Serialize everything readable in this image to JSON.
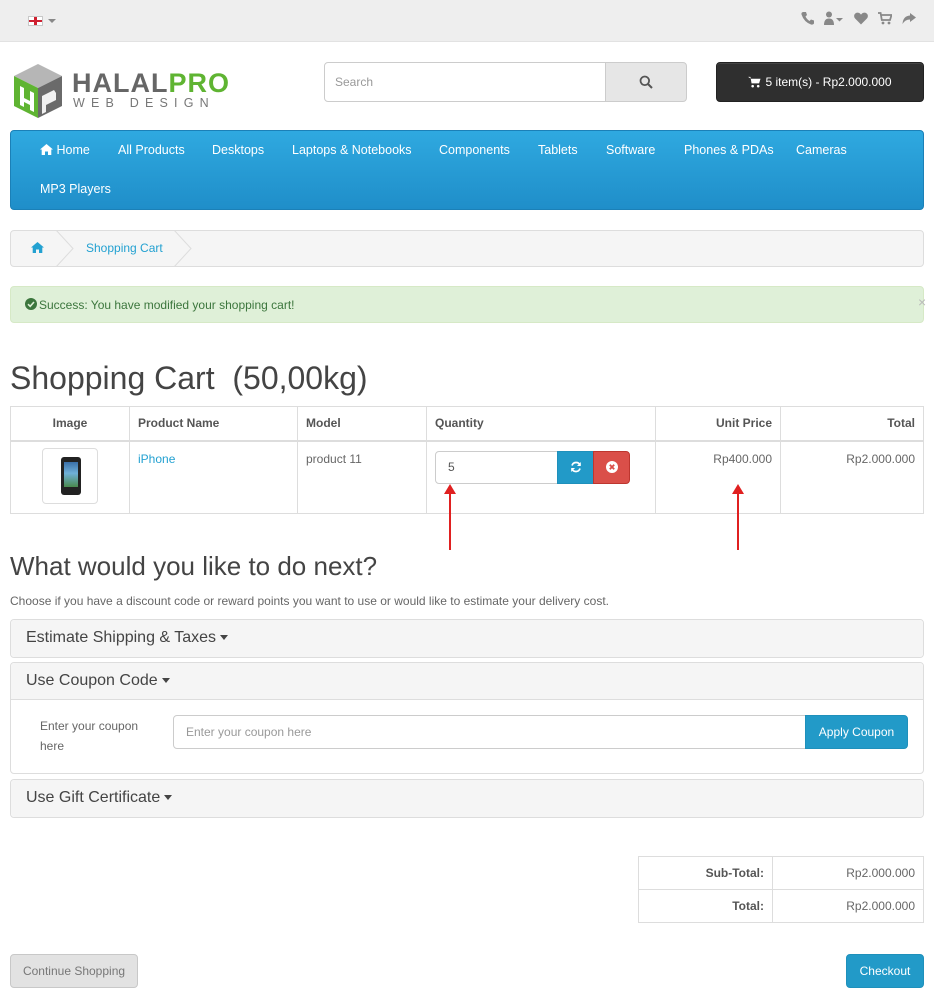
{
  "header": {
    "logo_main_a": "HALAL",
    "logo_main_b": "PRO",
    "logo_sub": "WEB DESIGN",
    "search_placeholder": "Search",
    "cart_label": "5 item(s) - Rp2.000.000"
  },
  "nav": {
    "items": [
      "Home",
      "All Products",
      "Desktops",
      "Laptops & Notebooks",
      "Components",
      "Tablets",
      "Software",
      "Phones & PDAs",
      "Cameras",
      "MP3 Players"
    ]
  },
  "breadcrumb": {
    "current": "Shopping Cart"
  },
  "alert": {
    "message": "Success: You have modified your shopping cart!",
    "close": "×"
  },
  "cart": {
    "title": "Shopping Cart  (50,00kg)",
    "columns": [
      "Image",
      "Product Name",
      "Model",
      "Quantity",
      "Unit Price",
      "Total"
    ],
    "rows": [
      {
        "product_name": "iPhone",
        "model": "product 11",
        "quantity": "5",
        "unit_price": "Rp400.000",
        "total": "Rp2.000.000"
      }
    ]
  },
  "next": {
    "title": "What would you like to do next?",
    "intro": "Choose if you have a discount code or reward points you want to use or would like to estimate your delivery cost.",
    "shipping_title": "Estimate Shipping & Taxes",
    "coupon_title": "Use Coupon Code",
    "coupon_label": "Enter your coupon here",
    "coupon_placeholder": "Enter your coupon here",
    "coupon_button": "Apply Coupon",
    "gift_title": "Use Gift Certificate"
  },
  "totals": {
    "subtotal_label": "Sub-Total:",
    "subtotal_value": "Rp2.000.000",
    "total_label": "Total:",
    "total_value": "Rp2.000.000"
  },
  "buttons": {
    "continue": "Continue Shopping",
    "checkout": "Checkout"
  },
  "colors": {
    "accent": "#229ac8",
    "nav": "#2fa9e0",
    "danger": "#da4f49",
    "success_bg": "#dff0d8",
    "annotation_arrow": "#e02020"
  }
}
